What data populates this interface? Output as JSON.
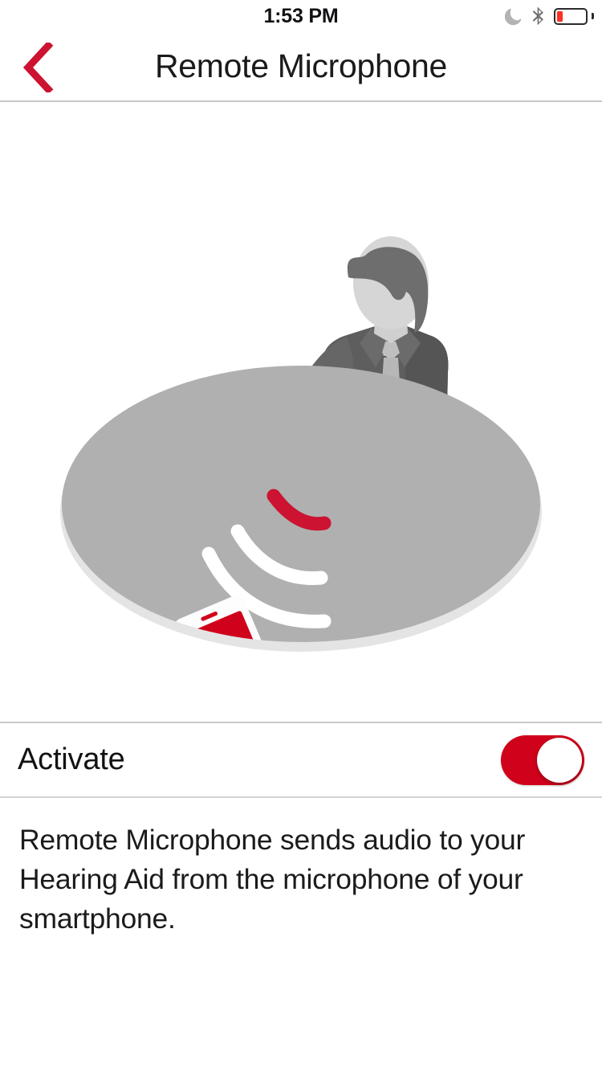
{
  "status_bar": {
    "time": "1:53 PM",
    "icons": [
      {
        "name": "do-not-disturb-moon-icon",
        "label": "Do Not Disturb"
      },
      {
        "name": "bluetooth-icon",
        "label": "Bluetooth"
      },
      {
        "name": "battery-icon",
        "label": "Battery"
      }
    ],
    "battery_percent": 20
  },
  "nav_bar": {
    "title": "Remote Microphone",
    "back_icon": "chevron-left-icon",
    "back_label": "Back"
  },
  "illustration": {
    "alt": "Man seated at a round table with a smartphone transmitting sound waves",
    "elements": [
      "person-figure",
      "table-ellipse",
      "sound-waves",
      "smartphone"
    ]
  },
  "activate": {
    "label": "Activate",
    "toggle_state": "on",
    "toggle_name": "activate-toggle"
  },
  "description": {
    "text": "Remote Microphone sends audio to your Hearing Aid from the microphone of your smartphone."
  },
  "colors": {
    "brand_red": "#d0021b",
    "battery_red": "#fc3027",
    "separator": "#c8c8cc",
    "table_grey": "#b0b0b0",
    "table_edge": "#e2e2e2",
    "suit_dark": "#5e5e5e",
    "suit_mid": "#7e7e7e",
    "skin_light": "#d6d6d6",
    "text_primary": "#1a1a1a"
  }
}
